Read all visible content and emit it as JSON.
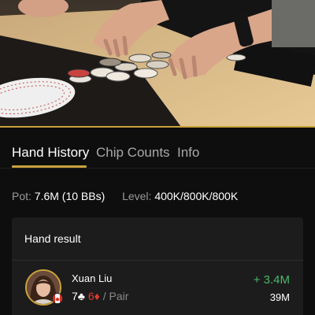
{
  "tabs": [
    {
      "label": "Hand History",
      "active": true
    },
    {
      "label": "Chip Counts",
      "active": false
    },
    {
      "label": "Info",
      "active": false
    }
  ],
  "stats": {
    "pot_label": "Pot:",
    "pot_value": "7.6M (10 BBs)",
    "level_label": "Level:",
    "level_value": "400K/800K/800K"
  },
  "hand_result": {
    "title": "Hand result",
    "player": {
      "name": "Xuan Liu",
      "country_flag": "canada-flag",
      "hole_cards": [
        {
          "rank": "7",
          "suit": "♣",
          "suit_name": "clubs"
        },
        {
          "rank": "6",
          "suit": "♦",
          "suit_name": "diamonds"
        }
      ],
      "separator": "/",
      "hand": "Pair",
      "winnings": "+ 3.4M",
      "stack": "39M"
    }
  },
  "colors": {
    "accent_gold": "#c9a13b",
    "win_green": "#4bb86a",
    "diamond_red": "#e2392b",
    "background": "#0e0e0e",
    "card_bg": "#1c1c1c"
  }
}
